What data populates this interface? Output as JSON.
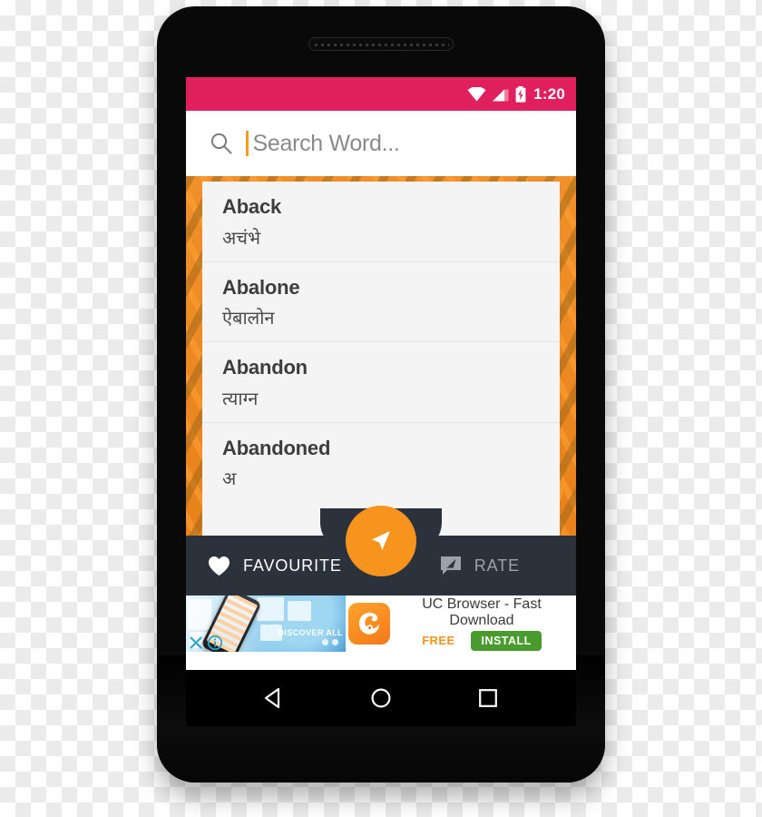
{
  "device": {
    "type": "android-phone-mockup",
    "bezel_color": "#090909"
  },
  "status_bar": {
    "time": "1:20",
    "background_color": "#e01f5e",
    "icons": [
      "wifi-icon",
      "signal-icon",
      "battery-charging-icon"
    ]
  },
  "search": {
    "icon": "search-icon",
    "placeholder": "Search Word...",
    "value": "",
    "caret_color": "#f89b1c"
  },
  "word_list": {
    "background_color": "#ee8a21",
    "card_color": "#f4f4f4",
    "items": [
      {
        "english": "Aback",
        "hindi": "अचंभे"
      },
      {
        "english": "Abalone",
        "hindi": "ऐबालोन"
      },
      {
        "english": "Abandon",
        "hindi": "त्याग्न"
      },
      {
        "english": "Abandoned",
        "hindi": "अ"
      }
    ]
  },
  "bottom_bar": {
    "background_color": "#2b323c",
    "favourite": {
      "label": "FAVOURITE",
      "icon": "heart-icon"
    },
    "rate": {
      "label": "RATE",
      "icon": "rate-comment-icon"
    },
    "fab": {
      "icon": "send-arrow-icon",
      "color": "#f7941d"
    }
  },
  "ad": {
    "title": "UC Browser - Fast Download",
    "price_label": "FREE",
    "cta_label": "INSTALL",
    "cta_color": "#4a9b2e",
    "promo_text": "DISCOVER ALL",
    "close_icon": "close-icon",
    "info_icon": "info-icon",
    "logo_icon": "uc-browser-squirrel-icon"
  },
  "nav_bar": {
    "back": "back-triangle-icon",
    "home": "home-circle-icon",
    "recents": "recents-square-icon"
  }
}
